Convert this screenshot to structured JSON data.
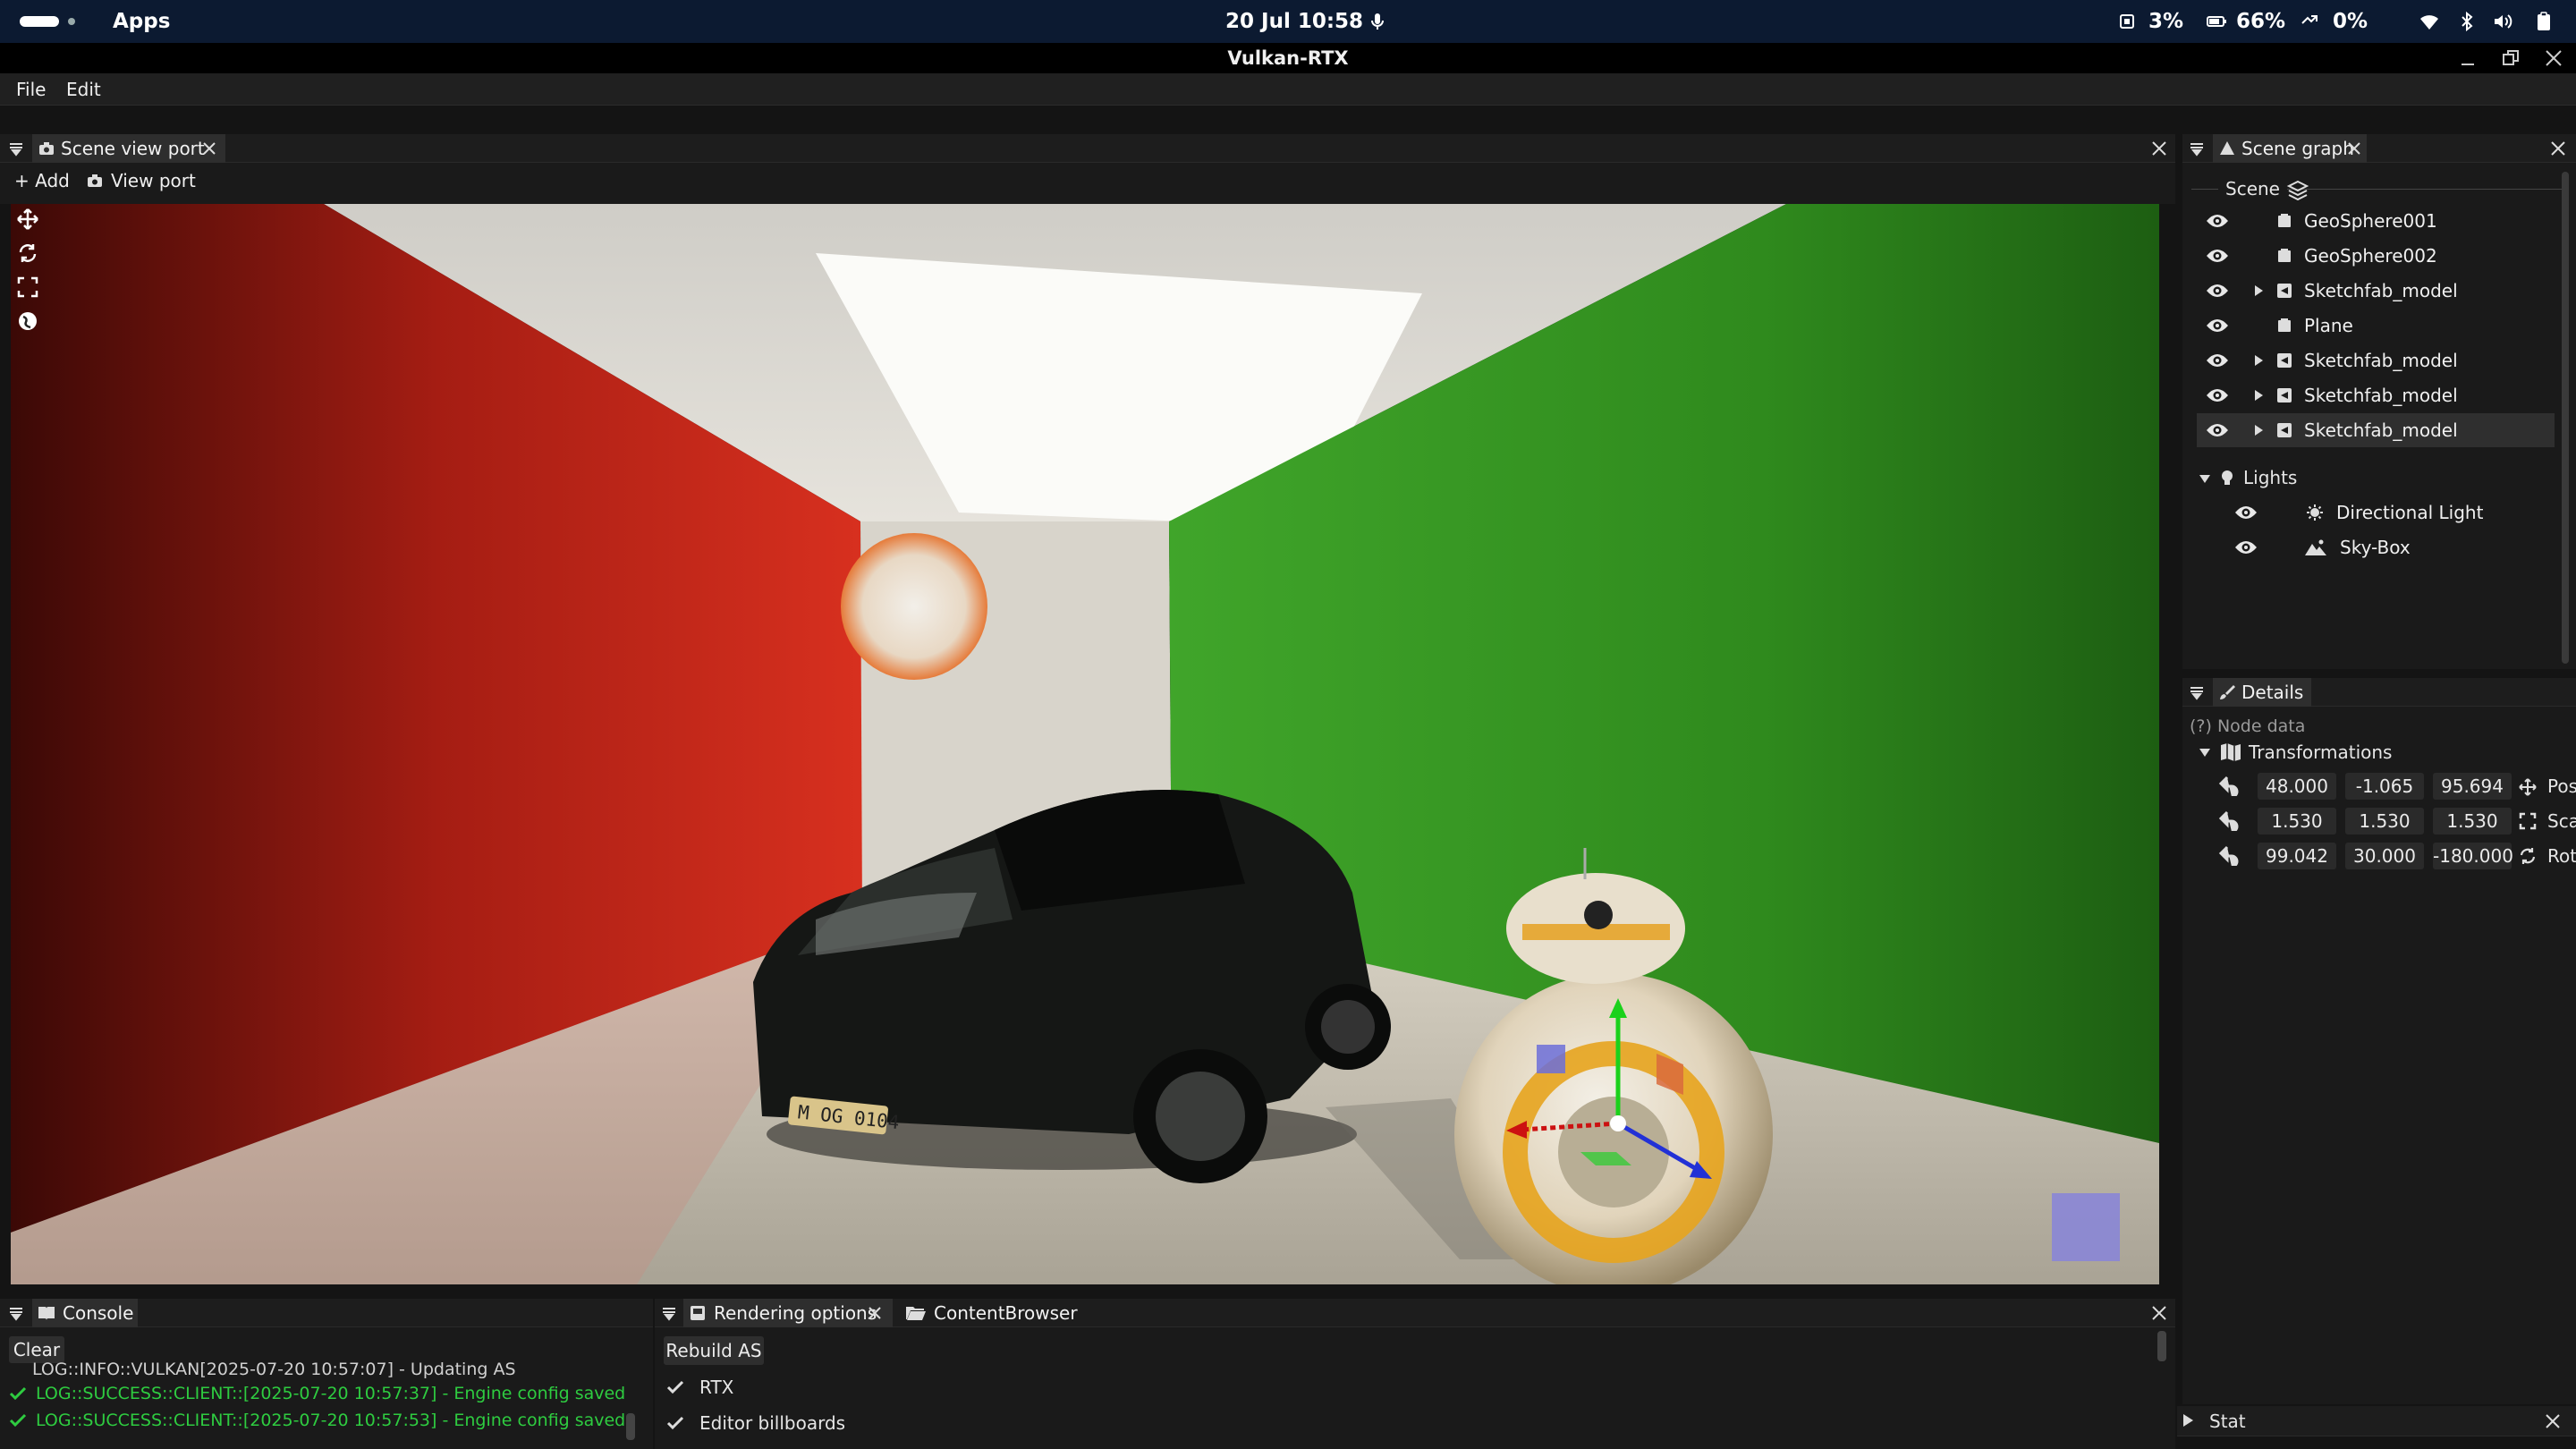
{
  "system_bar": {
    "apps_label": "Apps",
    "datetime": "20 Jul  10:58",
    "cpu": "3%",
    "battery": "66%",
    "sync": "0%"
  },
  "window": {
    "title": "Vulkan-RTX"
  },
  "menu": {
    "file": "File",
    "edit": "Edit"
  },
  "viewport_panel": {
    "tab_label": "Scene view port",
    "add_label": "+ Add",
    "viewport_label": "View port",
    "plate_text": "M OG 0104"
  },
  "scene_graph": {
    "tab_label": "Scene graph",
    "scene_label": "Scene",
    "items": [
      {
        "label": "GeoSphere001"
      },
      {
        "label": "GeoSphere002"
      },
      {
        "label": "Sketchfab_model"
      },
      {
        "label": "Plane"
      },
      {
        "label": "Sketchfab_model"
      },
      {
        "label": "Sketchfab_model"
      },
      {
        "label": "Sketchfab_model"
      }
    ],
    "lights_label": "Lights",
    "lights": [
      {
        "label": "Directional Light"
      },
      {
        "label": "Sky-Box"
      }
    ]
  },
  "details": {
    "tab_label": "Details",
    "node_data": "(?) Node data",
    "transformations": "Transformations",
    "position": {
      "x": "48.000",
      "y": "-1.065",
      "z": "95.694",
      "label": "Pos"
    },
    "scale": {
      "x": "1.530",
      "y": "1.530",
      "z": "1.530",
      "label": "Sca"
    },
    "rotation": {
      "x": "99.042",
      "y": "30.000",
      "z": "-180.000",
      "label": "Rot"
    }
  },
  "console": {
    "tab_label": "Console",
    "clear_label": "Clear",
    "lines": [
      "LOG::INFO::VULKAN[2025-07-20 10:57:07] - Updating AS",
      "LOG::SUCCESS::CLIENT::[2025-07-20 10:57:37] - Engine config saved",
      "LOG::SUCCESS::CLIENT::[2025-07-20 10:57:53] - Engine config saved"
    ]
  },
  "rendering": {
    "tab_label": "Rendering options",
    "content_browser_label": "ContentBrowser",
    "rebuild_label": "Rebuild AS",
    "rtx_label": "RTX",
    "billboards_label": "Editor billboards"
  },
  "stat": {
    "label": "Stat"
  },
  "colors": {
    "system_bar": "#0c1a31",
    "accent_selected_tab": "#2e2e2e",
    "success_green": "#2ecc40",
    "wall_red": "#c9251a",
    "wall_green": "#2f8f1e"
  }
}
